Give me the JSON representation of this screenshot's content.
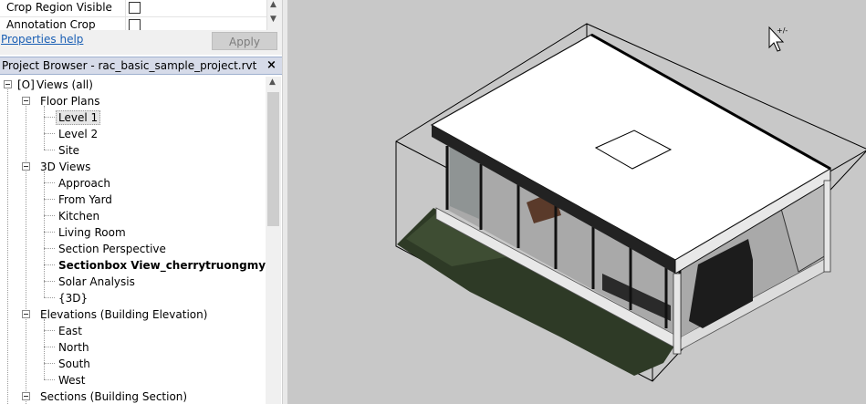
{
  "properties": {
    "rows": [
      {
        "label": "Crop Region Visible",
        "checked": false
      },
      {
        "label": "Annotation Crop",
        "checked": false
      }
    ],
    "help_link": "Properties help",
    "apply_label": "Apply"
  },
  "project_browser": {
    "title": "Project Browser - rac_basic_sample_project.rvt",
    "close_glyph": "×",
    "tree": {
      "root": "Views (all)",
      "floor_plans": {
        "label": "Floor Plans",
        "items": [
          "Level 1",
          "Level 2",
          "Site"
        ],
        "selected": "Level 1"
      },
      "views_3d": {
        "label": "3D Views",
        "items": [
          "Approach",
          "From Yard",
          "Kitchen",
          "Living Room",
          "Section Perspective",
          "Sectionbox View_cherrytruongmyhoa",
          "Solar Analysis",
          "{3D}"
        ],
        "bold": "Sectionbox View_cherrytruongmyhoa"
      },
      "elevations": {
        "label": "Elevations (Building Elevation)",
        "items": [
          "East",
          "North",
          "South",
          "West"
        ]
      },
      "sections": {
        "label": "Sections (Building Section)"
      }
    }
  },
  "viewport": {
    "background": "#c8c8c8",
    "cursor_icon": "arrow-cursor-plus-icon"
  },
  "colors": {
    "header_bg": "#d6dbe9",
    "link": "#1a5fb4"
  }
}
